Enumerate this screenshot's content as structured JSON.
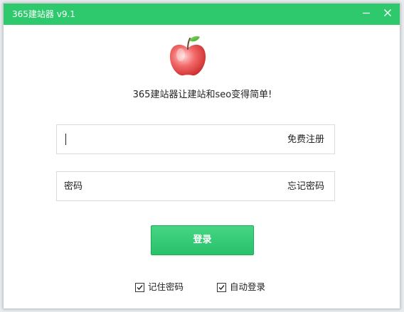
{
  "window": {
    "title": "365建站器 v9.1",
    "accent_color": "#2fc96d",
    "controls": {
      "minimize_icon": "minimize-icon",
      "close_icon": "close-icon"
    }
  },
  "logo": {
    "icon": "apple-icon"
  },
  "tagline": "365建站器让建站和seo变得简单!",
  "login_form": {
    "username": {
      "value": "",
      "placeholder": "",
      "link": "免费注册"
    },
    "password": {
      "value": "",
      "placeholder": "密码",
      "link": "忘记密码"
    },
    "submit_label": "登录",
    "options": [
      {
        "label": "记住密码",
        "checked": true
      },
      {
        "label": "自动登录",
        "checked": true
      }
    ]
  }
}
